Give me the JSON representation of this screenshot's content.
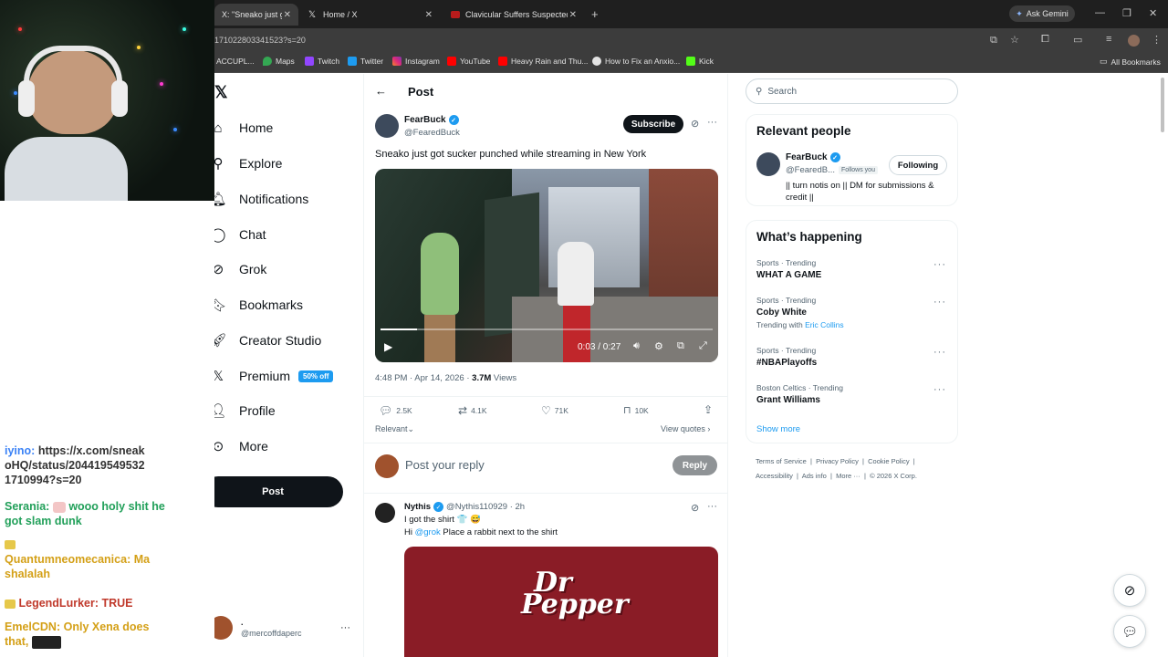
{
  "browser": {
    "tabs": [
      {
        "label": "X: \"Sneako just got",
        "active": true
      },
      {
        "label": "Home / X",
        "active": false
      },
      {
        "label": "Clavicular Suffers Suspected O",
        "active": false
      }
    ],
    "ask_gemini": "Ask Gemini",
    "url": "1710228033415​23?s=20",
    "bookmarks": [
      "ACCUPL...",
      "Maps",
      "Twitch",
      "Twitter",
      "Instagram",
      "YouTube",
      "Heavy Rain and Thu...",
      "How to Fix an Anxio...",
      "Kick"
    ],
    "all_bookmarks": "All Bookmarks"
  },
  "chat": [
    {
      "user": "iyino:",
      "text": "https://x.com/sneak oHQ/status/204419549532 1710994?s=20",
      "color": "#3b82f6"
    },
    {
      "user": "Serania:",
      "text": "wooo holy shit he got slam dunk",
      "color": "#22a05a"
    },
    {
      "user": "Quantumneomecanica:",
      "text": "Ma shalalah",
      "color": "#d4a017"
    },
    {
      "user": "LegendLurker:",
      "text": "TRUE",
      "color": "#c0392b"
    },
    {
      "user": "EmelCDN:",
      "text": "Only Xena does that,",
      "color": "#d4a017"
    }
  ],
  "nav": {
    "items": [
      "Home",
      "Explore",
      "Notifications",
      "Chat",
      "Grok",
      "Bookmarks",
      "Creator Studio",
      "Premium",
      "Profile",
      "More"
    ],
    "premium_badge": "50% off",
    "post_button": "Post",
    "account_name": ".",
    "account_handle": "@mercoffdaperc"
  },
  "post": {
    "header": "Post",
    "author": "FearBuck",
    "handle": "@FearedBuck",
    "subscribe": "Subscribe",
    "text": "Sneako just got sucker punched while streaming in New York",
    "video_time": "0:03 / 0:27",
    "video_progress": 0.11,
    "timestamp": "4:48 PM · Apr 14, 2026 · ",
    "views_count": "3.7M",
    "views_label": " Views",
    "replies": "2.5K",
    "reposts": "4.1K",
    "likes": "71K",
    "bookmarks": "10K",
    "relevant": "Relevant",
    "view_quotes": "View quotes",
    "reply_placeholder": "Post your reply",
    "reply_button": "Reply"
  },
  "reply_tweet": {
    "author": "Nythis",
    "handle": "@Nythis110929 · 2h",
    "line1": "I got the shirt 👕 😅",
    "line2_prefix": "Hi ",
    "mention": "@grok",
    "line2_rest": " Place a rabbit next to the shirt",
    "shirt_text_1": "Dr",
    "shirt_text_2": "Pepper"
  },
  "sidebar": {
    "search_placeholder": "Search",
    "relevant_title": "Relevant people",
    "person_name": "FearBuck",
    "person_handle": "@FearedB...",
    "follows_you": "Follows you",
    "following": "Following",
    "person_bio": "|| turn notis on || DM for submissions & credit ||",
    "happening_title": "What’s happening",
    "trends": [
      {
        "meta": "Sports · Trending",
        "title": "WHAT A GAME",
        "extra": ""
      },
      {
        "meta": "Sports · Trending",
        "title": "Coby White",
        "extra": "Trending with",
        "extra_link": "Eric Collins"
      },
      {
        "meta": "Sports · Trending",
        "title": "#NBAPlayoffs",
        "extra": ""
      },
      {
        "meta": "Boston Celtics · Trending",
        "title": "Grant Williams",
        "extra": ""
      }
    ],
    "show_more": "Show more",
    "footer1": [
      "Terms of Service",
      "Privacy Policy",
      "Cookie Policy"
    ],
    "footer2": [
      "Accessibility",
      "Ads info",
      "More ···",
      "© 2026 X Corp."
    ]
  },
  "colors": {
    "accent": "#1d9bf0",
    "text": "#0f1419",
    "muted": "#536471",
    "chrome": "#3c3c3c"
  }
}
